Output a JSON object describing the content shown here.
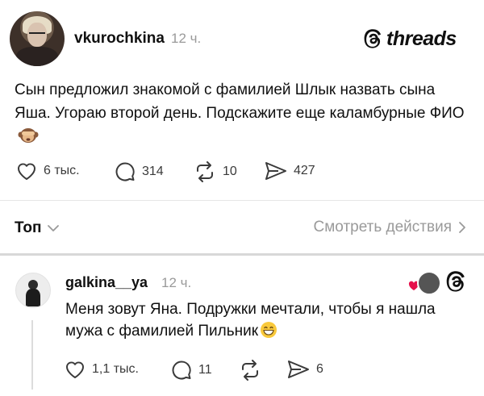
{
  "post": {
    "username": "vkurochkina",
    "time": "12 ч.",
    "brand": "threads",
    "text": "Сын предложил знакомой с фамилией Шлык назвать сына Яша. Угораю второй день. Подскажите еще каламбурные ФИО",
    "emoji": "see-no-evil-monkey",
    "actions": {
      "likes": "6 тыс.",
      "comments": "314",
      "reposts": "10",
      "shares": "427"
    }
  },
  "replies_bar": {
    "sort_label": "Топ",
    "view_activity": "Смотреть действия"
  },
  "reply": {
    "username": "galkina__ya",
    "time": "12 ч.",
    "text": "Меня зовут Яна. Подружки мечтали, чтобы я нашла мужа с фамилией Пильник",
    "emoji": "grinning-face",
    "actions": {
      "likes": "1,1 тыс.",
      "comments": "11",
      "shares": "6"
    }
  },
  "colors": {
    "text": "#101010",
    "muted": "#9a9a9a",
    "like_heart": "#e5114c"
  }
}
